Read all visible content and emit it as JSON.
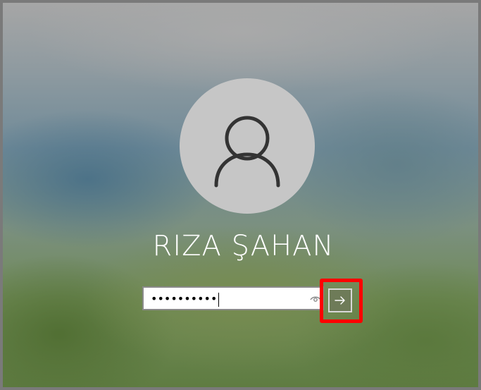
{
  "user": {
    "display_name": "RIZA ŞAHAN",
    "avatar_icon": "user-avatar-icon"
  },
  "password": {
    "value": "••••••••••",
    "reveal_icon": "eye-reveal-icon"
  },
  "submit": {
    "icon": "arrow-right-icon"
  },
  "colors": {
    "highlight": "#ff0000",
    "submit_bg": "#6e7b58",
    "avatar_bg": "#c6c6c6"
  }
}
